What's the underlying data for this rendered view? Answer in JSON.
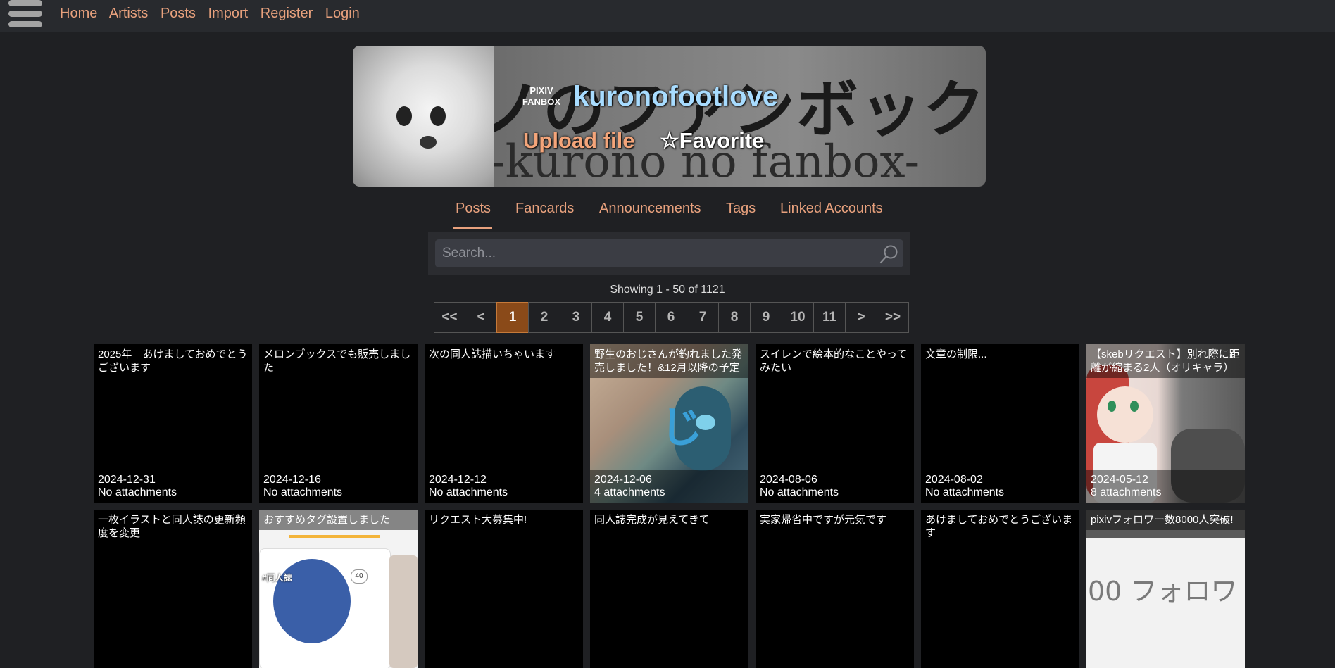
{
  "nav": {
    "links": [
      "Home",
      "Artists",
      "Posts",
      "Import",
      "Register",
      "Login"
    ]
  },
  "artist": {
    "service_logo_line1": "PIXIV",
    "service_logo_line2": "FANBOX",
    "name": "kuronofootlove",
    "upload_label": "Upload file",
    "favorite_label": "☆Favorite",
    "banner_text": "ノのファンボックス",
    "banner_subtext": "-kurono no fanbox-"
  },
  "tabs": [
    "Posts",
    "Fancards",
    "Announcements",
    "Tags",
    "Linked Accounts"
  ],
  "search": {
    "placeholder": "Search..."
  },
  "showing": "Showing 1 - 50 of 1121",
  "pager": [
    "<<",
    "<",
    "1",
    "2",
    "3",
    "4",
    "5",
    "6",
    "7",
    "8",
    "9",
    "10",
    "11",
    ">",
    ">>"
  ],
  "pager_current": "1",
  "posts": [
    {
      "title": "2025年　あけましておめでとうございます",
      "date": "2024-12-31",
      "attachments": "No attachments"
    },
    {
      "title": "メロンブックスでも販売しました",
      "date": "2024-12-16",
      "attachments": "No attachments"
    },
    {
      "title": "次の同人誌描いちゃいます",
      "date": "2024-12-12",
      "attachments": "No attachments"
    },
    {
      "title": "野生のおじさんが釣れました発売しました！&12月以降の予定",
      "date": "2024-12-06",
      "attachments": "4 attachments"
    },
    {
      "title": "スイレンで絵本的なことやってみたい",
      "date": "2024-08-06",
      "attachments": "No attachments"
    },
    {
      "title": "文章の制限...",
      "date": "2024-08-02",
      "attachments": "No attachments"
    },
    {
      "title": "【skebリクエスト】別れ際に距離が縮まる2人（オリキャラ）",
      "date": "2024-05-12",
      "attachments": "8 attachments"
    },
    {
      "title": "一枚イラストと同人誌の更新頻度を変更",
      "date": "",
      "attachments": ""
    },
    {
      "title": "おすすめタグ設置しました",
      "date": "",
      "attachments": ""
    },
    {
      "title": "リクエスト大募集中!",
      "date": "",
      "attachments": ""
    },
    {
      "title": "同人誌完成が見えてきて",
      "date": "",
      "attachments": ""
    },
    {
      "title": "実家帰省中ですが元気です",
      "date": "",
      "attachments": ""
    },
    {
      "title": "あけましておめでとうございます",
      "date": "",
      "attachments": ""
    },
    {
      "title": "pixivフォロワー数8000人突破!",
      "date": "",
      "attachments": ""
    }
  ],
  "thumb_text": {
    "tag_label": "#同人誌",
    "tag_count": "40",
    "follower_text": "00 フォロワ"
  },
  "colors": {
    "accent": "#e8a17d",
    "artist_name": "#a8dcff",
    "page_current": "#8a4a19"
  }
}
